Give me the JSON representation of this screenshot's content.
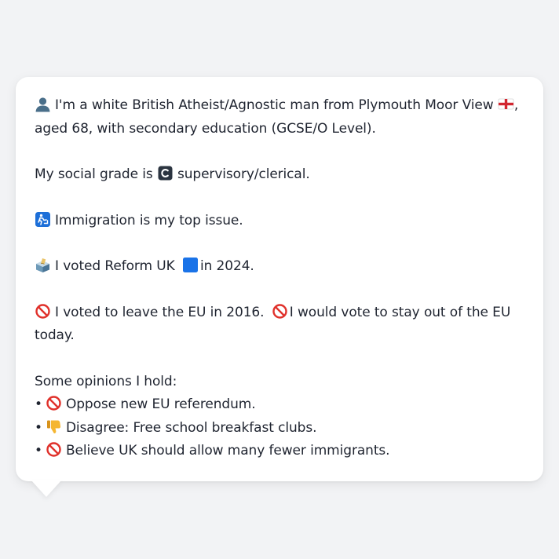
{
  "profile": {
    "intro_line": "I'm a white British Atheist/Agnostic man from Plymouth Moor View",
    "intro_suffix": ",",
    "intro_line2": "aged 68, with secondary education (GCSE/O Level).",
    "grade_prefix": "My social grade is",
    "grade_suffix": "supervisory/clerical.",
    "top_issue": "Immigration is my top issue.",
    "vote_prefix": "I voted Reform UK",
    "vote_suffix": "in 2024.",
    "eu_2016": "I voted to leave the EU in 2016.",
    "eu_today": "I would vote to stay out of the EU",
    "eu_today_line2": "today.",
    "opinions_heading": "Some opinions I hold:",
    "bullet_char": "•",
    "opinions": [
      {
        "icon": "prohibited-icon",
        "text": "Oppose new EU referendum."
      },
      {
        "icon": "thumbs-down-icon",
        "text": "Disagree: Free school breakfast clubs."
      },
      {
        "icon": "prohibited-icon",
        "text": "Believe UK should allow many fewer immigrants."
      }
    ]
  },
  "colors": {
    "background": "#f2f3f5",
    "card": "#ffffff",
    "text": "#1f2430",
    "reform_blue": "#1a73e8",
    "prohibited_red": "#e0312b"
  }
}
